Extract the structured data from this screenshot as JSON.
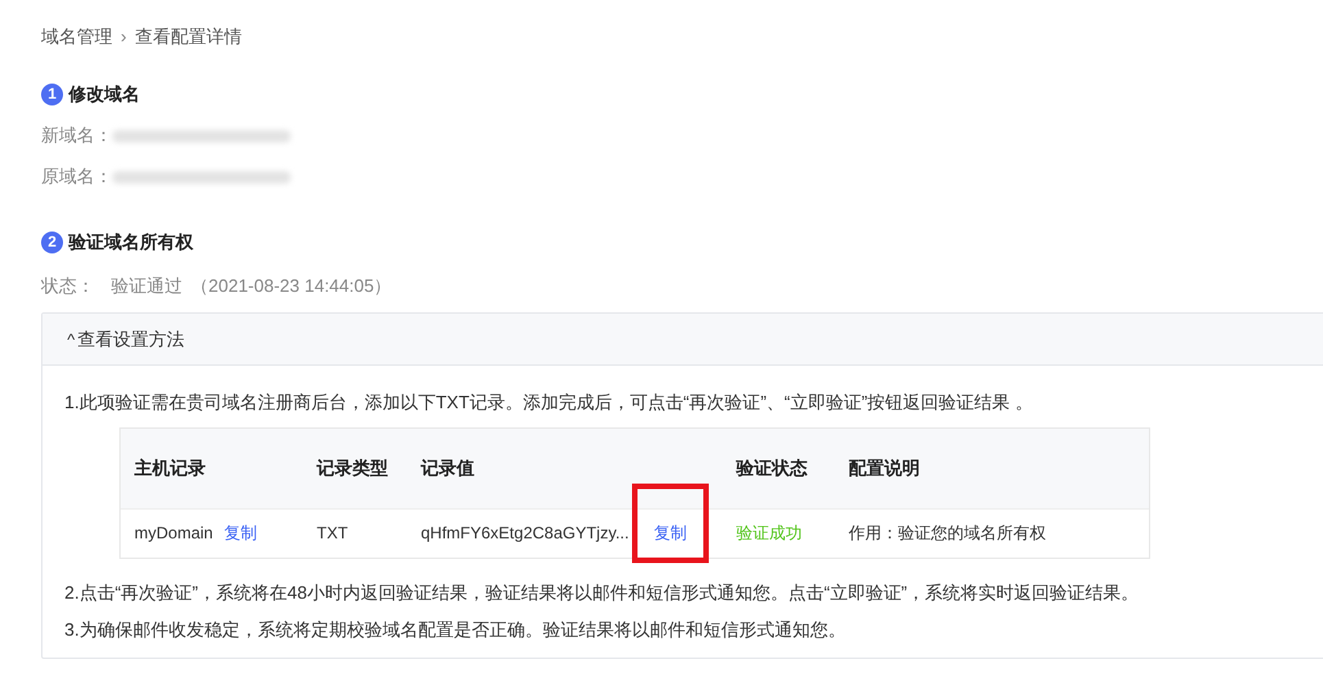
{
  "breadcrumb": [
    {
      "label": "域名管理"
    },
    {
      "label": "查看配置详情"
    }
  ],
  "breadcrumb_separator": "›",
  "sections": [
    {
      "number": "1",
      "title": "修改域名",
      "fields": [
        {
          "label": "新域名：",
          "redacted": true
        },
        {
          "label": "原域名：",
          "redacted": true
        }
      ]
    },
    {
      "number": "2",
      "title": "验证域名所有权",
      "status_label": "状态：",
      "status": "验证通过",
      "status_time": "（2021-08-23 14:44:05）"
    }
  ],
  "panel": {
    "expanded": true,
    "caret": "^",
    "title": "查看设置方法",
    "steps": [
      "1.此项验证需在贵司域名注册商后台，添加以下TXT记录。添加完成后，可点击“再次验证”、“立即验证”按钮返回验证结果 。"
    ],
    "table": {
      "columns": [
        "主机记录",
        "记录类型",
        "记录值",
        "验证状态",
        "配置说明"
      ],
      "rows": [
        {
          "host": "myDomain",
          "host_copy": "复制",
          "type": "TXT",
          "value": "qHfmFY6xEtg2C8aGYTjzy...",
          "value_copy": "复制",
          "value_copy_highlighted": true,
          "status": "验证成功",
          "color": "#52c41a",
          "note": "作用：验证您的域名所有权"
        }
      ]
    },
    "notes": [
      "2.点击“再次验证”，系统将在48小时内返回验证结果，验证结果将以邮件和短信形式通知您。点击“立即验证”，系统将实时返回验证结果。",
      "3.为确保邮件收发稳定，系统将定期校验域名配置是否正确。验证结果将以邮件和短信形式通知您。"
    ]
  }
}
